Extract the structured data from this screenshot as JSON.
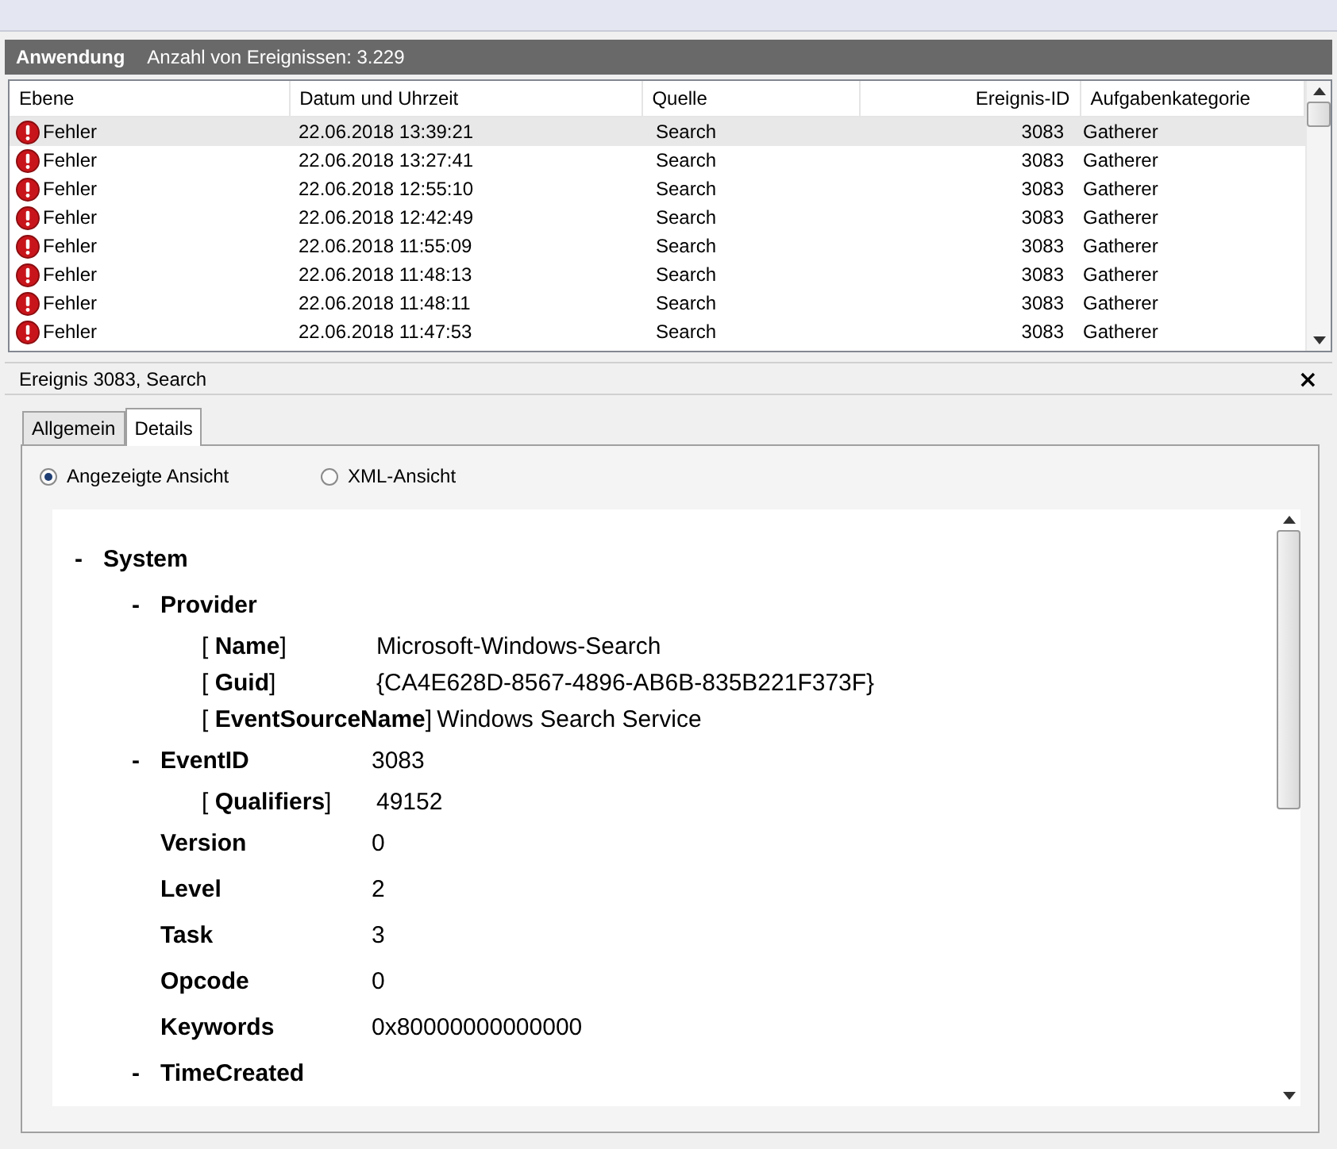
{
  "log_header": {
    "title": "Anwendung",
    "count": "Anzahl von Ereignissen: 3.229"
  },
  "table": {
    "columns": [
      {
        "label": "Ebene"
      },
      {
        "label": "Datum und Uhrzeit"
      },
      {
        "label": "Quelle"
      },
      {
        "label": "Ereignis-ID"
      },
      {
        "label": "Aufgabenkategorie"
      }
    ],
    "rows": [
      {
        "level": "Fehler",
        "kind": "error",
        "date": "22.06.2018 13:39:21",
        "source": "Search",
        "event_id": "3083",
        "category": "Gatherer",
        "selected": true
      },
      {
        "level": "Fehler",
        "kind": "error",
        "date": "22.06.2018 13:27:41",
        "source": "Search",
        "event_id": "3083",
        "category": "Gatherer",
        "selected": false
      },
      {
        "level": "Fehler",
        "kind": "error",
        "date": "22.06.2018 12:55:10",
        "source": "Search",
        "event_id": "3083",
        "category": "Gatherer",
        "selected": false
      },
      {
        "level": "Fehler",
        "kind": "error",
        "date": "22.06.2018 12:42:49",
        "source": "Search",
        "event_id": "3083",
        "category": "Gatherer",
        "selected": false
      },
      {
        "level": "Fehler",
        "kind": "error",
        "date": "22.06.2018 11:55:09",
        "source": "Search",
        "event_id": "3083",
        "category": "Gatherer",
        "selected": false
      },
      {
        "level": "Fehler",
        "kind": "error",
        "date": "22.06.2018 11:48:13",
        "source": "Search",
        "event_id": "3083",
        "category": "Gatherer",
        "selected": false
      },
      {
        "level": "Fehler",
        "kind": "error",
        "date": "22.06.2018 11:48:11",
        "source": "Search",
        "event_id": "3083",
        "category": "Gatherer",
        "selected": false
      },
      {
        "level": "Fehler",
        "kind": "error",
        "date": "22.06.2018 11:47:53",
        "source": "Search",
        "event_id": "3083",
        "category": "Gatherer",
        "selected": false
      }
    ]
  },
  "details": {
    "title": "Ereignis 3083, Search",
    "close": "×",
    "tabs": [
      {
        "label": "Allgemein",
        "selected": false
      },
      {
        "label": "Details",
        "selected": true
      }
    ],
    "views": [
      {
        "label": "Angezeigte Ansicht",
        "selected": true
      },
      {
        "label": "XML-Ansicht",
        "selected": false
      }
    ],
    "tree": [
      {
        "kind": "element",
        "expander": "-",
        "name": "System",
        "children": [
          {
            "kind": "element",
            "expander": "-",
            "name": "Provider",
            "children": [
              {
                "kind": "attribute",
                "name": "[ **Name**]",
                "value": "Microsoft-Windows-Search"
              },
              {
                "kind": "attribute",
                "name": "[ **Guid**]",
                "value": "{CA4E628D-8567-4896-AB6B-835B221F373F}"
              },
              {
                "kind": "attribute",
                "name": "[ **EventSourceName**]",
                "value": "Windows Search Service"
              }
            ]
          },
          {
            "kind": "element",
            "expander": "-",
            "name": "EventID",
            "value": "3083",
            "children": [
              {
                "kind": "attribute",
                "name": "[ **Qualifiers**]",
                "value": "49152"
              }
            ]
          },
          {
            "kind": "element",
            "name": "Version",
            "value": "0"
          },
          {
            "kind": "element",
            "name": "Level",
            "value": "2"
          },
          {
            "kind": "element",
            "name": "Task",
            "value": "3"
          },
          {
            "kind": "element",
            "name": "Opcode",
            "value": "0"
          },
          {
            "kind": "element",
            "name": "Keywords",
            "value": "0x80000000000000"
          },
          {
            "kind": "element",
            "expander": "-",
            "name": "TimeCreated"
          }
        ]
      }
    ]
  }
}
